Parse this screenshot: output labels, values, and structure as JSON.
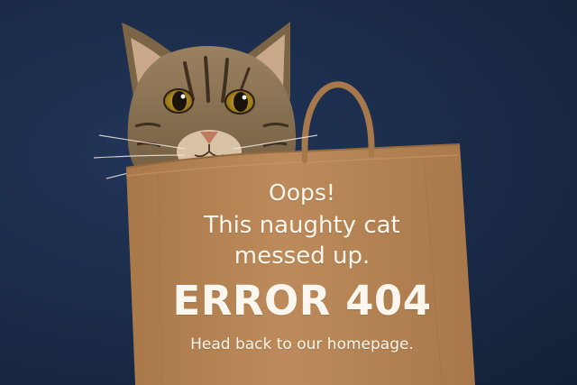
{
  "error_page": {
    "headline": "Oops!",
    "message_lines": [
      "This naughty cat",
      "messed up."
    ],
    "error_code": "ERROR 404",
    "home_link_label": "Head back to our homepage."
  },
  "colors": {
    "background": "#1c2c45",
    "bag": "#b78555",
    "text": "#fbf6ee",
    "cat_fur": "#8d7452",
    "cat_eyes": "#b68e1e"
  },
  "icons": [
    "tabby-cat-illustration",
    "paper-bag-illustration"
  ]
}
